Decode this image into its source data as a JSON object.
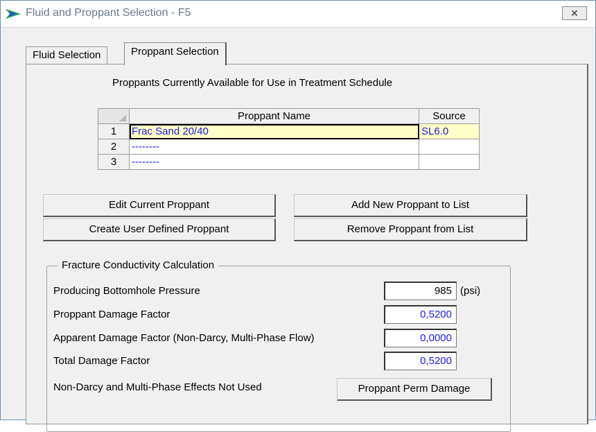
{
  "window": {
    "title": "Fluid and Proppant Selection - F5",
    "close_label": "✕"
  },
  "tabs": [
    {
      "label": "Fluid Selection"
    },
    {
      "label": "Proppant Selection"
    }
  ],
  "proppants": {
    "heading": "Proppants Currently Available for Use in Treatment Schedule",
    "columns": [
      "Proppant Name",
      "Source"
    ],
    "rows": [
      {
        "num": "1",
        "name": "Frac Sand 20/40",
        "source": "SL6.0"
      },
      {
        "num": "2",
        "name": "--------",
        "source": ""
      },
      {
        "num": "3",
        "name": "--------",
        "source": ""
      }
    ]
  },
  "buttons": {
    "edit": "Edit Current Proppant",
    "add": "Add New Proppant to List",
    "create": "Create User Defined Proppant",
    "remove": "Remove Proppant from List",
    "perm_damage": "Proppant Perm Damage"
  },
  "conductivity": {
    "title": "Fracture Conductivity Calculation",
    "bhp_label": "Producing Bottomhole Pressure",
    "bhp_value": "985",
    "bhp_unit": "(psi)",
    "damage_label": "Proppant Damage Factor",
    "damage_value": "0,5200",
    "apparent_label": "Apparent Damage Factor (Non-Darcy, Multi-Phase Flow)",
    "apparent_value": "0,0000",
    "total_label": "Total Damage Factor",
    "total_value": "0,5200",
    "note": "Non-Darcy and Multi-Phase Effects Not Used"
  },
  "colors": {
    "value_text": "#1a1ae6",
    "selected_row": "#ffffc6"
  }
}
